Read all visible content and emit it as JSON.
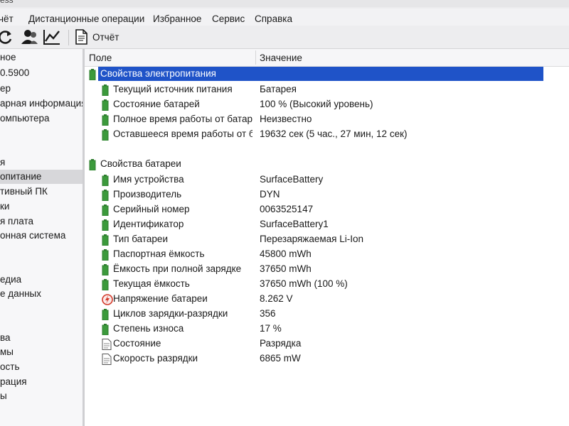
{
  "window": {
    "title_fragment": "ess"
  },
  "menu": {
    "items": [
      "чёт",
      "Дистанционные операции",
      "Избранное",
      "Сервис",
      "Справка"
    ]
  },
  "toolbar": {
    "icons": [
      "refresh-icon",
      "users-icon",
      "chart-icon",
      "report-document-icon"
    ],
    "report_label": "Отчёт"
  },
  "sidebar": {
    "items": [
      "ное",
      "0.5900",
      "ер",
      "арная информация",
      "омпьютера",
      "",
      "",
      "я",
      "опитание",
      "тивный ПК",
      "ки",
      "я плата",
      "онная система",
      "",
      "",
      "едиа",
      "е данных",
      "",
      "",
      "ва",
      "мы",
      "ость",
      "рация",
      "ы"
    ],
    "selected_index": 8
  },
  "table": {
    "columns": {
      "field": "Поле",
      "value": "Значение"
    },
    "groups": [
      {
        "title": "Свойства электропитания",
        "selected": true,
        "rows": [
          {
            "field": "Текущий источник питания",
            "value": "Батарея",
            "icon": "battery-icon"
          },
          {
            "field": "Состояние батарей",
            "value": "100 % (Высокий уровень)",
            "icon": "battery-icon"
          },
          {
            "field": "Полное время работы от батар...",
            "value": "Неизвестно",
            "icon": "battery-icon"
          },
          {
            "field": "Оставшееся время работы от б...",
            "value": "19632 сек (5 час., 27 мин, 12 сек)",
            "icon": "battery-icon"
          }
        ]
      },
      {
        "title": "Свойства батареи",
        "selected": false,
        "rows": [
          {
            "field": "Имя устройства",
            "value": "SurfaceBattery",
            "icon": "battery-icon"
          },
          {
            "field": "Производитель",
            "value": "DYN",
            "icon": "battery-icon"
          },
          {
            "field": "Серийный номер",
            "value": "0063525147",
            "icon": "battery-icon"
          },
          {
            "field": "Идентификатор",
            "value": "SurfaceBattery1",
            "icon": "battery-icon"
          },
          {
            "field": "Тип батареи",
            "value": "Перезаряжаемая Li-Ion",
            "icon": "battery-icon"
          },
          {
            "field": "Паспортная ёмкость",
            "value": "45800 mWh",
            "icon": "battery-icon"
          },
          {
            "field": "Ёмкость при полной зарядке",
            "value": "37650 mWh",
            "icon": "battery-icon"
          },
          {
            "field": "Текущая ёмкость",
            "value": "37650 mWh  (100 %)",
            "icon": "battery-icon"
          },
          {
            "field": "Напряжение батареи",
            "value": "8.262 V",
            "icon": "voltage-icon"
          },
          {
            "field": "Циклов зарядки-разрядки",
            "value": "356",
            "icon": "battery-icon"
          },
          {
            "field": "Степень износа",
            "value": "17 %",
            "icon": "battery-icon"
          },
          {
            "field": "Состояние",
            "value": "Разрядка",
            "icon": "document-icon"
          },
          {
            "field": "Скорость разрядки",
            "value": "6865 mW",
            "icon": "document-icon"
          }
        ]
      }
    ]
  },
  "colors": {
    "selection": "#1f53c8",
    "battery_green": "#3c9a3c",
    "voltage_red": "#d23a2a"
  }
}
